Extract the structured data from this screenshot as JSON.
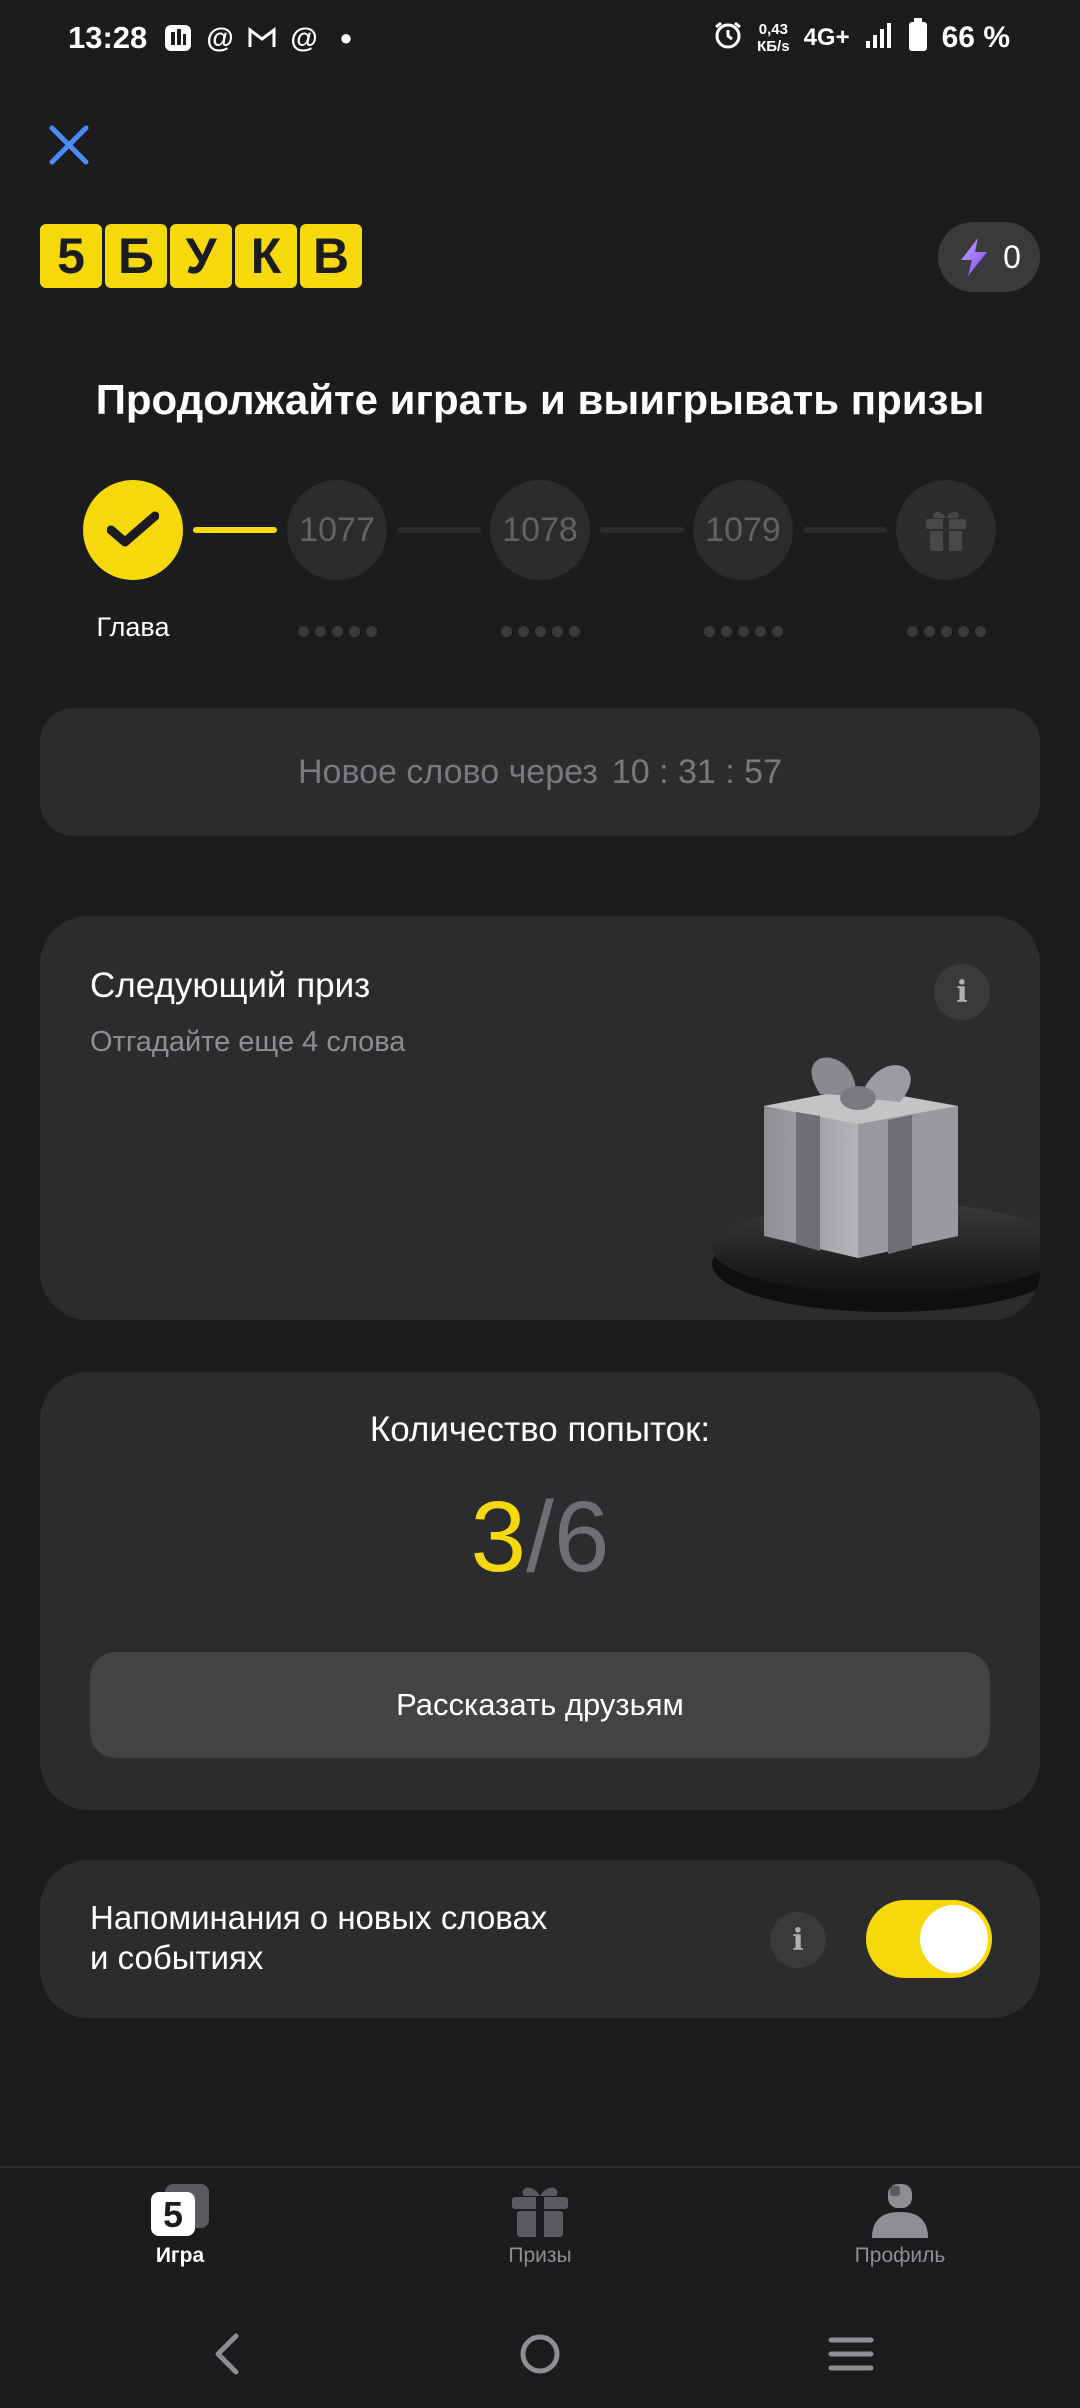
{
  "status_bar": {
    "time": "13:28",
    "net_speed_value": "0,43",
    "net_speed_unit": "КБ/s",
    "network": "4G+",
    "battery": "66 %"
  },
  "header": {
    "logo_letters": [
      "5",
      "Б",
      "У",
      "К",
      "В"
    ],
    "energy_count": "0",
    "close_icon": "close-icon",
    "energy_icon": "lightning-icon"
  },
  "title": "Продолжайте играть и выигрывать призы",
  "progress": {
    "done_label": "Глава",
    "steps": [
      "1077",
      "1078",
      "1079"
    ],
    "final_icon": "gift-icon"
  },
  "timer": {
    "label": "Новое слово через",
    "value": "10 : 31 : 57"
  },
  "prize": {
    "title": "Следующий приз",
    "subtitle": "Отгадайте еще 4 слова"
  },
  "attempts": {
    "title": "Количество попыток:",
    "used": "3",
    "separator": "/",
    "total": "6",
    "share_label": "Рассказать друзьям"
  },
  "reminders": {
    "line1": "Напоминания о новых словах",
    "line2": "и событиях",
    "enabled": true
  },
  "nav": {
    "items": [
      {
        "label": "Игра",
        "icon": "game-icon",
        "active": true
      },
      {
        "label": "Призы",
        "icon": "gift-icon",
        "active": false
      },
      {
        "label": "Профиль",
        "icon": "profile-icon",
        "active": false
      }
    ]
  },
  "colors": {
    "accent": "#f5d90a",
    "background": "#1c1c1e",
    "card": "#2c2c2e",
    "close": "#4a8cf7"
  }
}
